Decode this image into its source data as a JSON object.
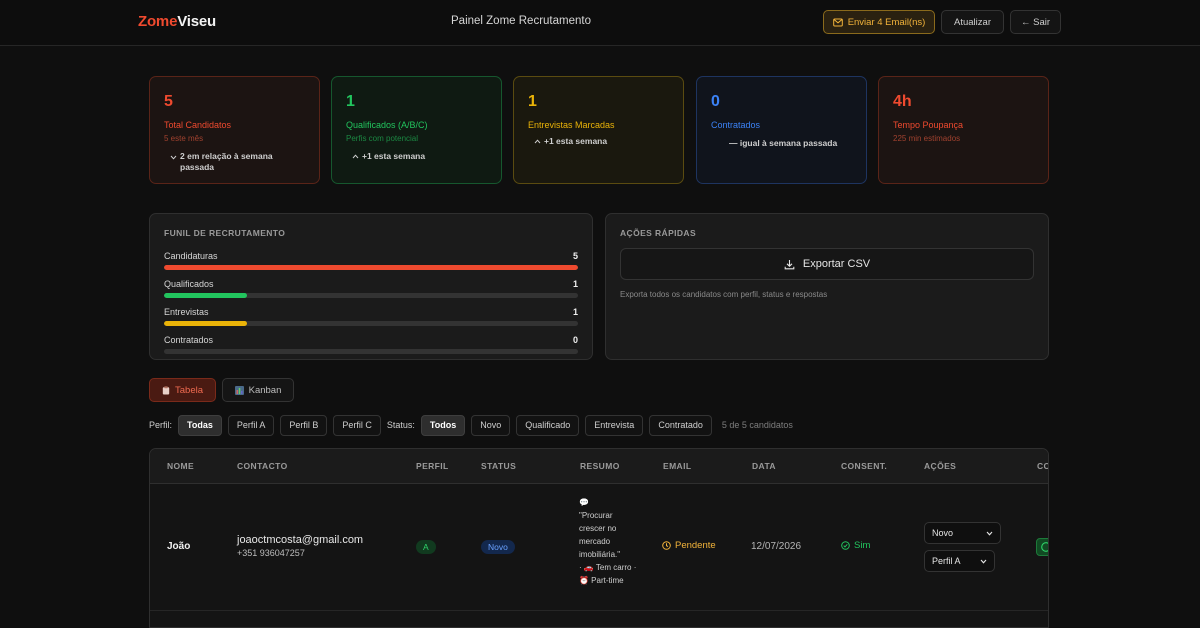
{
  "header": {
    "logo_part1": "Zome",
    "logo_part2": "Viseu",
    "title": "Painel Zome Recrutamento",
    "send_email_label": "Enviar 4 Email(ns)",
    "refresh_label": "Atualizar",
    "exit_label": "← Sair"
  },
  "stats": [
    {
      "value": "5",
      "label": "Total Candidatos",
      "sub": "5 este mês",
      "trend_icon": "chevron-down",
      "trend": "2 em relação à semana passada"
    },
    {
      "value": "1",
      "label": "Qualificados (A/B/C)",
      "sub": "Perfis com potencial",
      "trend_icon": "chevron-up",
      "trend": "+1 esta semana"
    },
    {
      "value": "1",
      "label": "Entrevistas Marcadas",
      "sub": "",
      "trend_icon": "chevron-up",
      "trend": "+1 esta semana"
    },
    {
      "value": "0",
      "label": "Contratados",
      "sub": "",
      "trend_icon": "dash",
      "trend": "— igual à semana passada"
    },
    {
      "value": "4h",
      "label": "Tempo Poupança",
      "sub": "225 min estimados",
      "trend_icon": "",
      "trend": ""
    }
  ],
  "funnel": {
    "title": "FUNIL DE RECRUTAMENTO",
    "stages": [
      {
        "label": "Candidaturas",
        "value": "5",
        "fraction": 1.0,
        "color": "#ef4a2f"
      },
      {
        "label": "Qualificados",
        "value": "1",
        "fraction": 0.2,
        "color": "#22c55e"
      },
      {
        "label": "Entrevistas",
        "value": "1",
        "fraction": 0.2,
        "color": "#eab308"
      },
      {
        "label": "Contratados",
        "value": "0",
        "fraction": 0,
        "color": "#3b82f6"
      }
    ]
  },
  "quick_actions": {
    "title": "AÇÕES RÁPIDAS",
    "export_label": "Exportar CSV",
    "export_note": "Exporta todos os candidatos com perfil, status e respostas"
  },
  "view_tabs": {
    "table": "Tabela",
    "kanban": "Kanban"
  },
  "filters": {
    "perfil_label": "Perfil:",
    "perfil_options": [
      "Todas",
      "Perfil A",
      "Perfil B",
      "Perfil C"
    ],
    "perfil_selected": "Todas",
    "status_label": "Status:",
    "status_options": [
      "Todos",
      "Novo",
      "Qualificado",
      "Entrevista",
      "Contratado"
    ],
    "status_selected": "Todos",
    "count_text": "5 de 5 candidatos"
  },
  "table": {
    "columns": [
      "NOME",
      "CONTACTO",
      "PERFIL",
      "STATUS",
      "RESUMO",
      "EMAIL",
      "DATA",
      "CONSENT.",
      "AÇÕES",
      "CO"
    ],
    "rows": [
      {
        "name": "João",
        "email": "joaoctmcosta@gmail.com",
        "phone": "+351 936047257",
        "perfil": "A",
        "status": "Novo",
        "resumo_line1": "💬",
        "resumo_text": "\"Procurar crescer no mercado imobiliária.\"",
        "resumo_tags": "· 🚗 Tem carro · ⏰ Part-time",
        "email_status": "Pendente",
        "date": "12/07/2026",
        "consent": "Sim",
        "status_select": "Novo",
        "perfil_select": "Perfil A"
      }
    ]
  },
  "colors": {
    "accent": "#ef4a2f",
    "green": "#22c55e",
    "yellow": "#eab308",
    "blue": "#3b82f6",
    "background": "#0f0f0f"
  }
}
